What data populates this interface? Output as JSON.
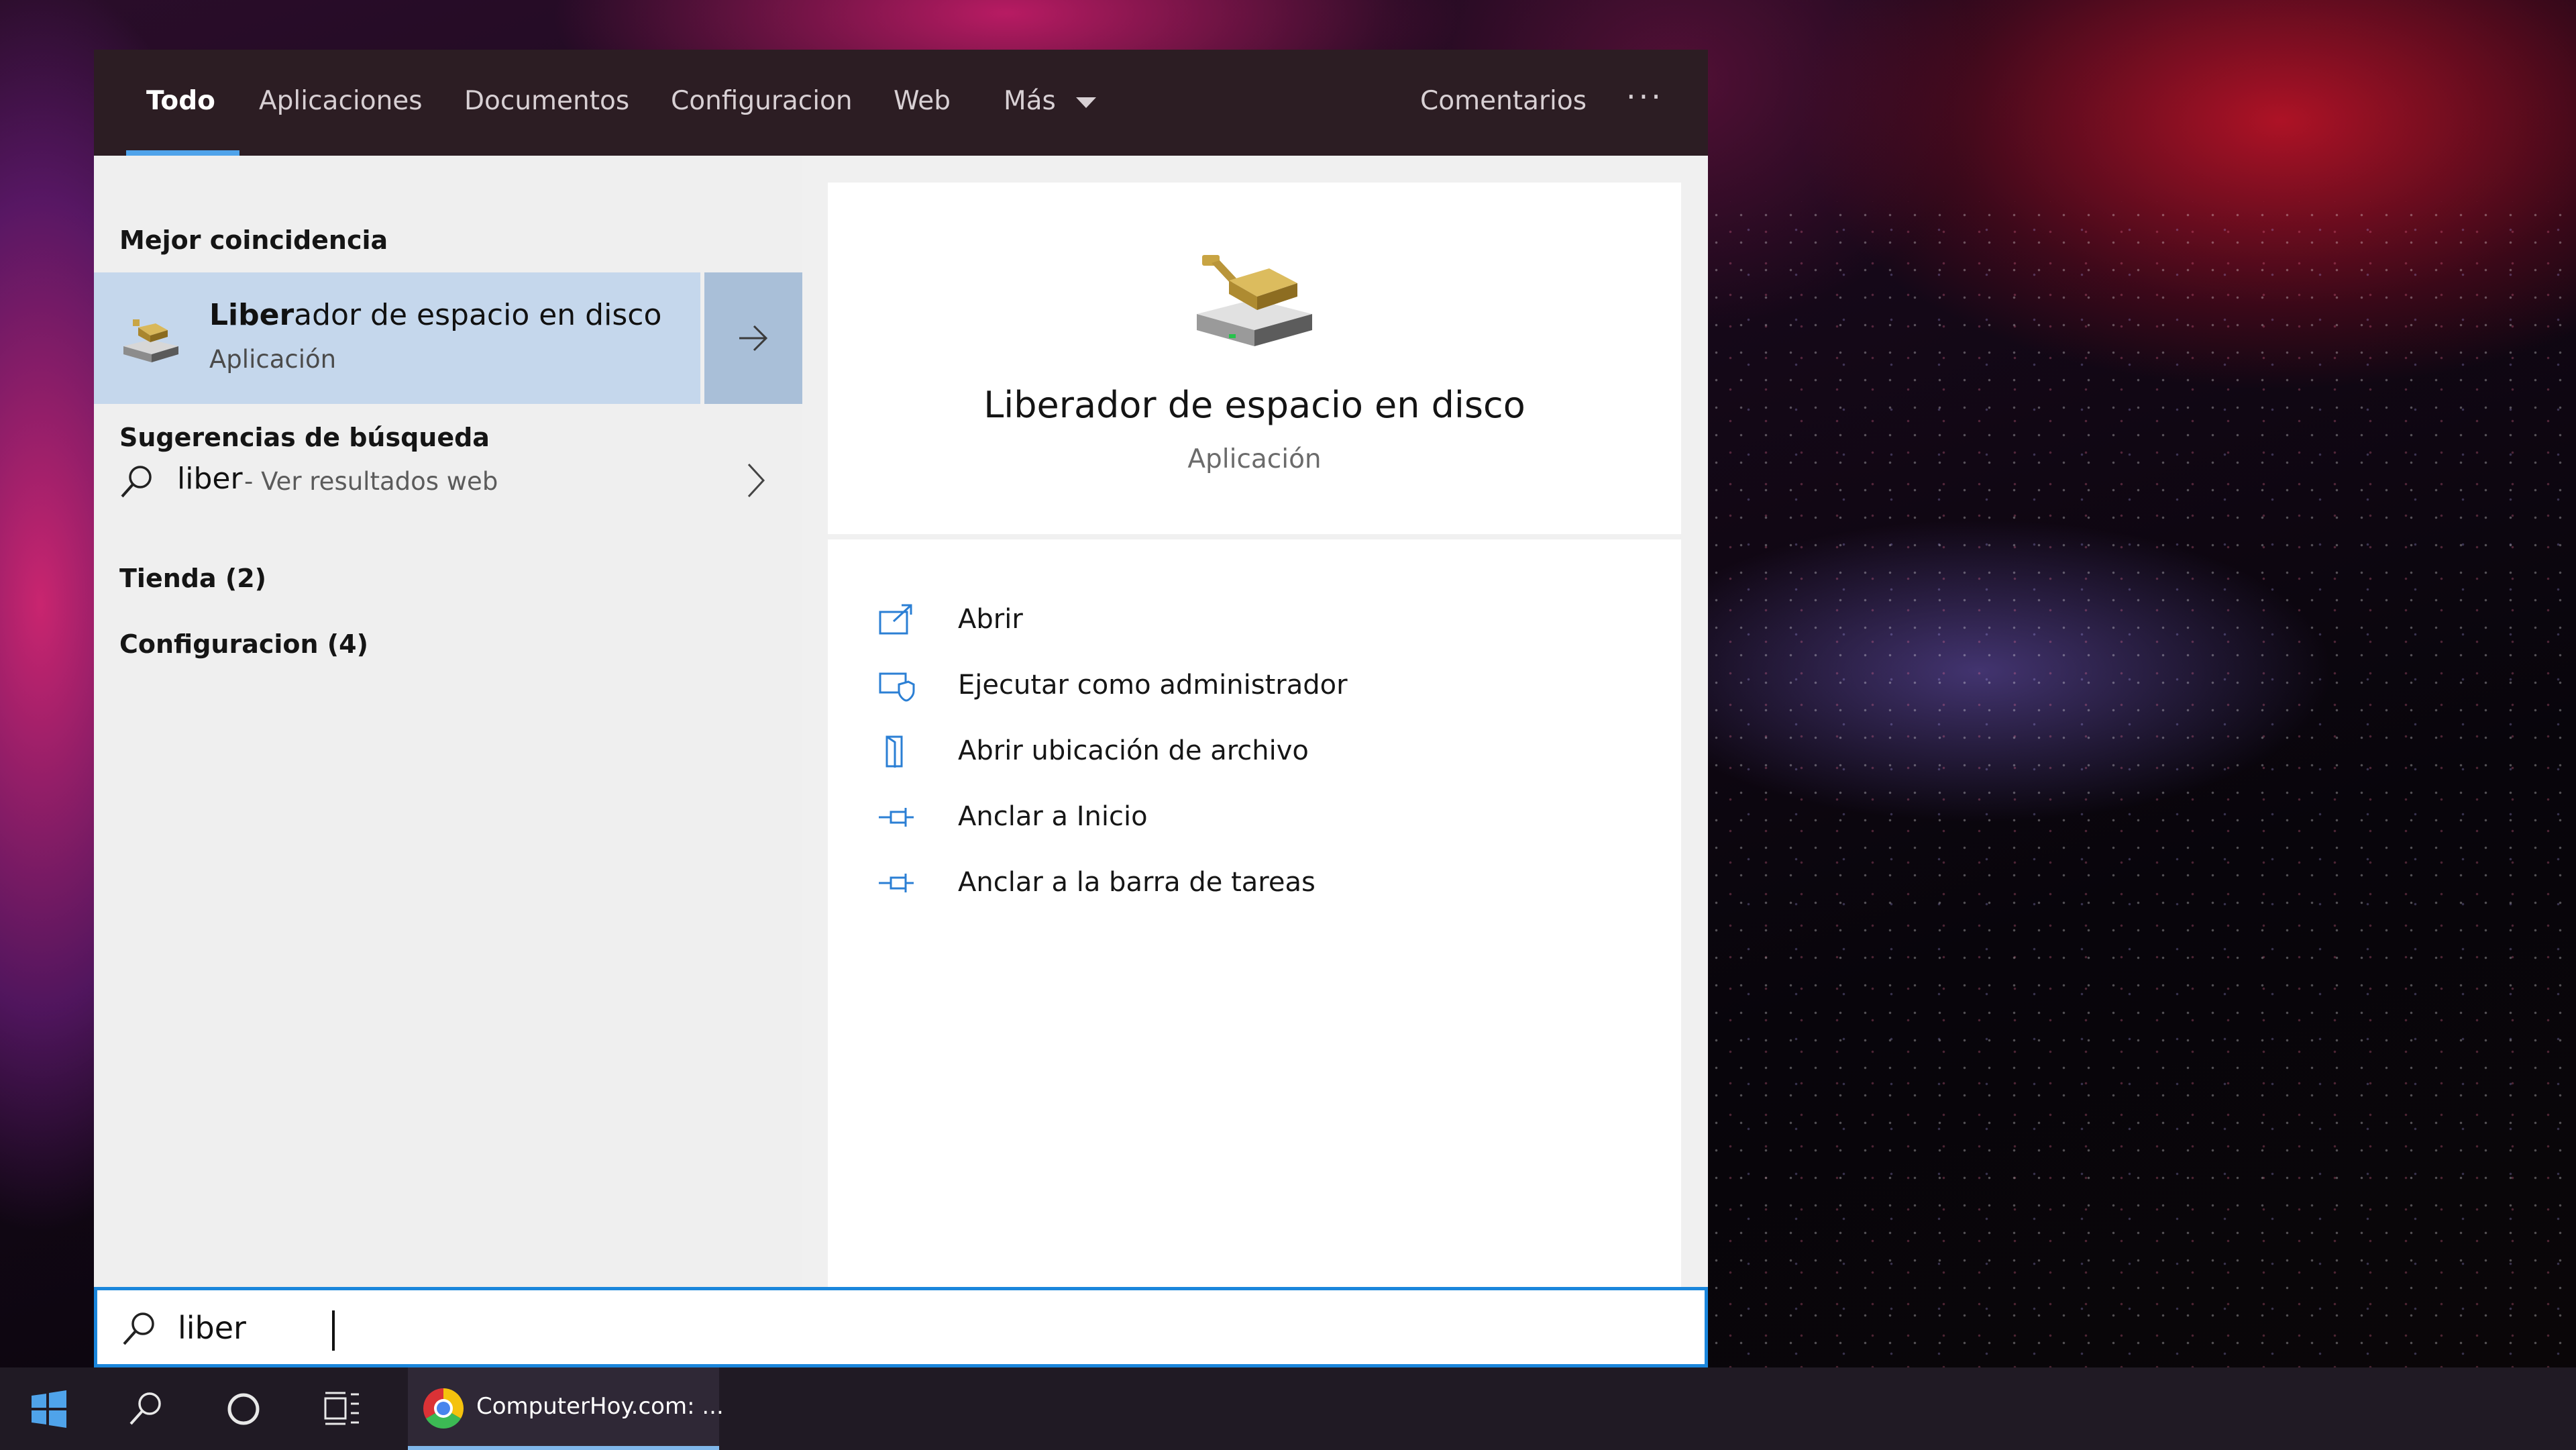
{
  "tabs": [
    {
      "label": "Todo",
      "active": true
    },
    {
      "label": "Aplicaciones"
    },
    {
      "label": "Documentos"
    },
    {
      "label": "Configuracion"
    },
    {
      "label": "Web"
    },
    {
      "label": "Más"
    }
  ],
  "header": {
    "feedback_label": "Comentarios",
    "more_options_label": "···"
  },
  "results": {
    "best_match_heading": "Mejor coincidencia",
    "best_match": {
      "title_highlight": "Liber",
      "title_rest": "ador de espacio en disco",
      "subtitle": "Aplicación"
    },
    "suggestions_heading": "Sugerencias de búsqueda",
    "suggestion": {
      "query": "liber",
      "hint": "- Ver resultados web"
    },
    "store_label": "Tienda (2)",
    "settings_label": "Configuracion (4)"
  },
  "details": {
    "title": "Liberador de espacio en disco",
    "subtitle": "Aplicación",
    "actions": [
      {
        "label": "Abrir",
        "icon": "open-icon"
      },
      {
        "label": "Ejecutar como administrador",
        "icon": "run-as-admin-icon"
      },
      {
        "label": "Abrir ubicación de archivo",
        "icon": "file-location-icon"
      },
      {
        "label": "Anclar a Inicio",
        "icon": "pin-icon"
      },
      {
        "label": "Anclar a la barra de tareas",
        "icon": "pin-icon"
      }
    ]
  },
  "search": {
    "value": "liber"
  },
  "taskbar": {
    "app_label": "ComputerHoy.com: ...",
    "app_icon": "chrome-icon"
  },
  "colors": {
    "accent": "#1a86dc",
    "tab_underline": "#4fa3ea",
    "selected_row": "#c5d7ec",
    "header_bg": "#2c1d23",
    "taskbar_bg": "#201a24"
  }
}
